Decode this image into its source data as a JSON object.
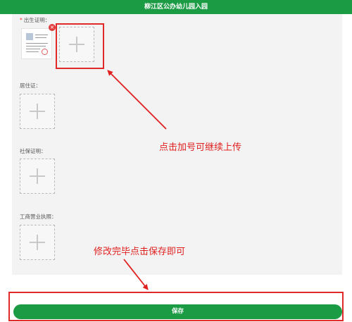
{
  "header": {
    "title": "柳江区公办幼儿园入园"
  },
  "form": {
    "required_marker": "*",
    "fields": [
      {
        "label": "出生证明："
      },
      {
        "label": "居住证："
      },
      {
        "label": "社保证明："
      },
      {
        "label": "工商营业执照："
      }
    ],
    "delete_glyph": "×"
  },
  "annotations": {
    "add_more": "点击加号可继续上传",
    "save_hint": "修改完毕点击保存即可"
  },
  "footer": {
    "save_label": "保存"
  },
  "colors": {
    "brand_green": "#1c9b45",
    "annotation_red": "#e0201f"
  },
  "icons": [
    "plus-icon",
    "document-thumbnail",
    "close-icon",
    "arrow-icon"
  ]
}
